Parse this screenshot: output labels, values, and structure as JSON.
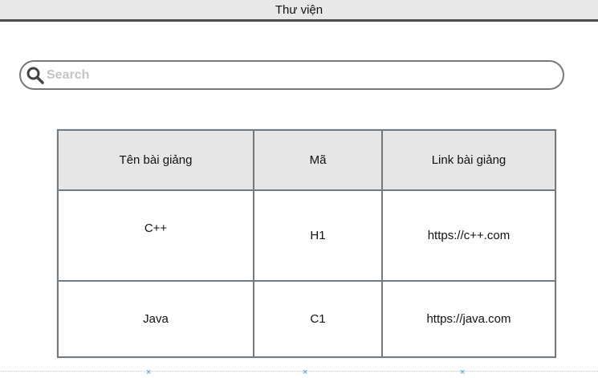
{
  "window": {
    "title": "Thư viện"
  },
  "search": {
    "placeholder": "Search",
    "value": ""
  },
  "table": {
    "headers": [
      "Tên bài giảng",
      "Mã",
      "Link bài giảng"
    ],
    "rows": [
      [
        "C++",
        "H1",
        "https://c++.com"
      ],
      [
        "Java",
        "C1",
        "https://java.com"
      ]
    ]
  },
  "footer": {
    "marks": [
      "×",
      "×",
      "×"
    ]
  },
  "colors": {
    "accent_marks": "#2a9ad6",
    "header_bg": "#e6e6e6",
    "border": "#707a80"
  }
}
